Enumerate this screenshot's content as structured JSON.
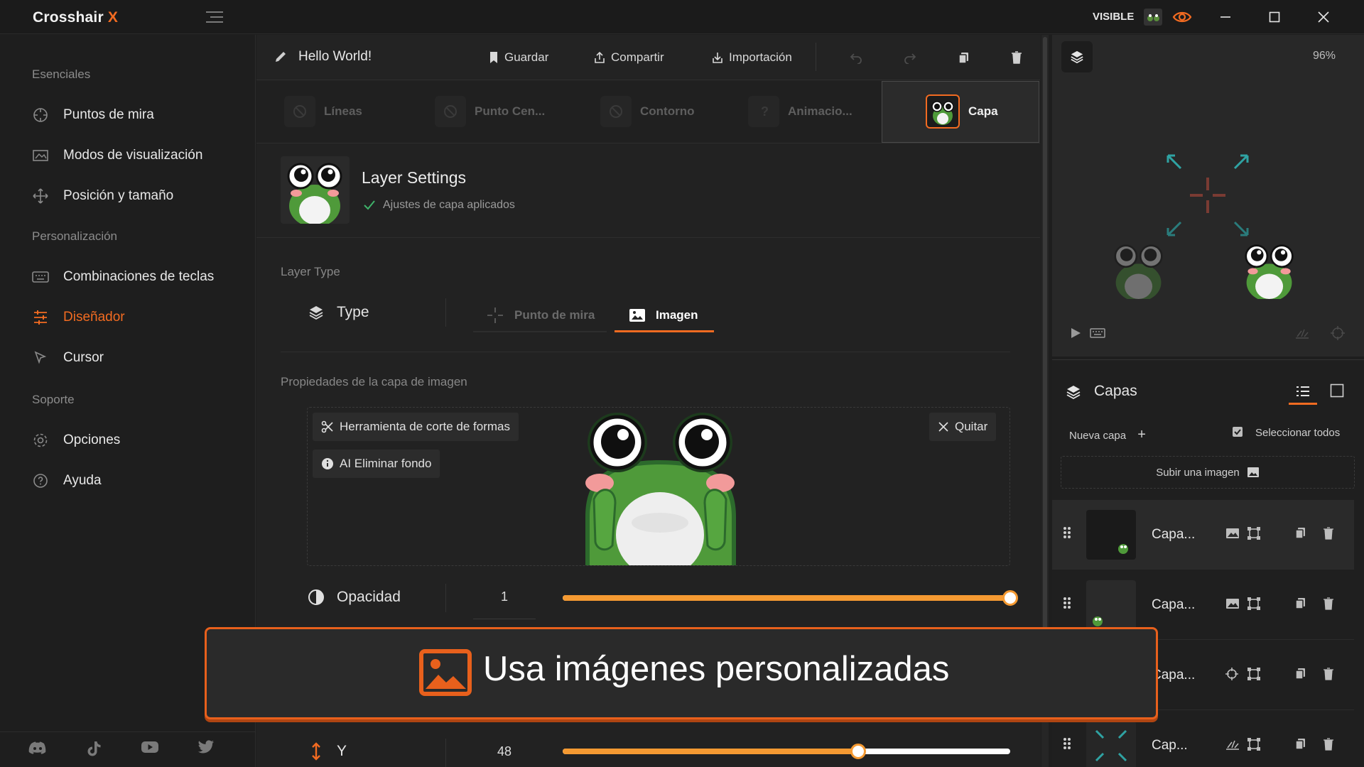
{
  "app": {
    "brand_main": "Crosshair",
    "brand_accent": "X",
    "visible_label": "VISIBLE",
    "accent": "#f26b21"
  },
  "sidebar": {
    "sections": [
      "Esenciales",
      "Personalización",
      "Soporte"
    ],
    "items": [
      {
        "label": "Puntos de mira",
        "icon": "crosshair-icon"
      },
      {
        "label": "Modos de visualización",
        "icon": "display-modes-icon"
      },
      {
        "label": "Posición y tamaño",
        "icon": "move-icon"
      },
      {
        "label": "Combinaciones de teclas",
        "icon": "keyboard-icon"
      },
      {
        "label": "Diseñador",
        "icon": "sliders-icon",
        "active": true
      },
      {
        "label": "Cursor",
        "icon": "cursor-icon"
      },
      {
        "label": "Opciones",
        "icon": "gear-icon"
      },
      {
        "label": "Ayuda",
        "icon": "help-icon"
      }
    ],
    "social": [
      "discord-icon",
      "tiktok-icon",
      "youtube-icon",
      "twitter-icon"
    ]
  },
  "toolbar": {
    "title": "Hello World!",
    "save": "Guardar",
    "share": "Compartir",
    "import": "Importación"
  },
  "tabs": [
    {
      "label": "Líneas"
    },
    {
      "label": "Punto Cen..."
    },
    {
      "label": "Contorno"
    },
    {
      "label": "Animacio..."
    },
    {
      "label": "Capa",
      "active": true
    }
  ],
  "layer_settings": {
    "title": "Layer Settings",
    "status": "Ajustes de capa aplicados",
    "layer_type_heading": "Layer Type",
    "type_label": "Type",
    "type_options": [
      "Punto de mira",
      "Imagen"
    ],
    "selected_type": "Imagen",
    "image_props_heading": "Propiedades de la capa de imagen",
    "shape_cut_tool": "Herramienta de corte de formas",
    "remove_bg": "AI Eliminar fondo",
    "remove_label": "Quitar"
  },
  "controls": {
    "opacity": {
      "label": "Opacidad",
      "value": "1",
      "fraction": 1.0
    },
    "y": {
      "label": "Y",
      "value": "48",
      "fraction": 0.66
    }
  },
  "banner": {
    "text": "Usa imágenes personalizadas"
  },
  "preview": {
    "zoom": "96%"
  },
  "layers_panel": {
    "title": "Capas",
    "new_layer": "Nueva capa",
    "select_all": "Seleccionar todos",
    "upload": "Subir una imagen",
    "rows": [
      {
        "name": "Capa..."
      },
      {
        "name": "Capa..."
      },
      {
        "name": "Capa..."
      },
      {
        "name": "Cap..."
      }
    ]
  }
}
